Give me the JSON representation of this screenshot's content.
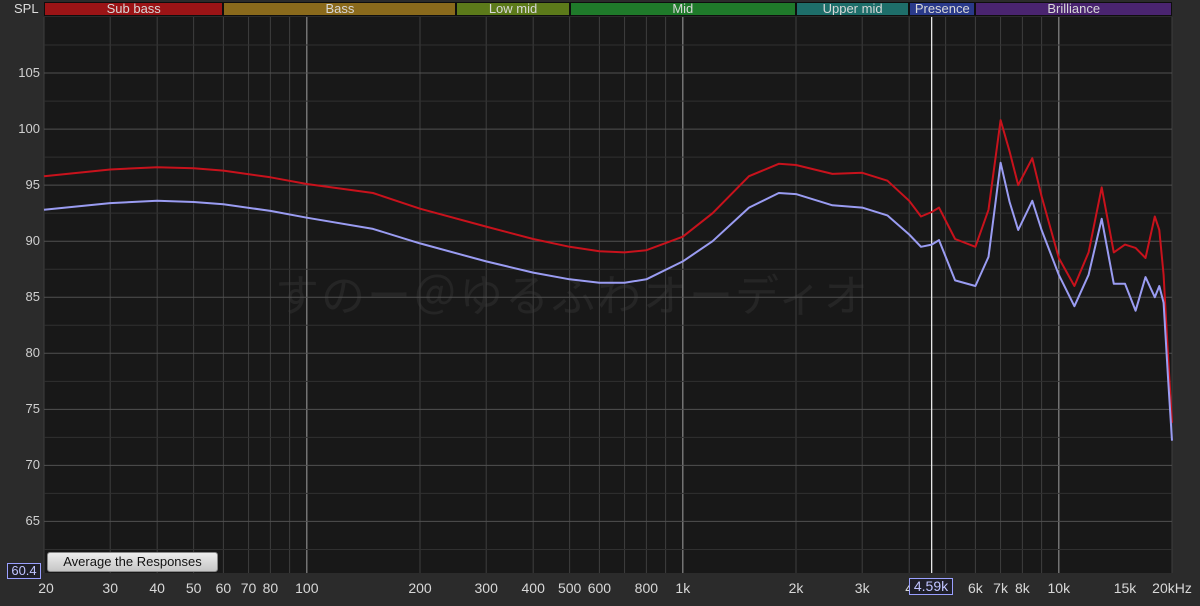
{
  "chart_data": {
    "type": "line",
    "ylabel": "SPL",
    "xscale": "log",
    "xlim": [
      20,
      20000
    ],
    "ylim": [
      60.4,
      110
    ],
    "yticks": [
      "105",
      "100",
      "95",
      "90",
      "85",
      "80",
      "75",
      "70",
      "65"
    ],
    "xticks": [
      "20",
      "30",
      "40",
      "50",
      "60",
      "70",
      "80",
      "100",
      "200",
      "300",
      "400",
      "500",
      "600",
      "800",
      "1k",
      "2k",
      "3k",
      "4",
      "6k",
      "7k",
      "8k",
      "10k",
      "15k",
      "20kHz"
    ],
    "bands": [
      {
        "name": "Sub bass",
        "from": 20,
        "to": 60,
        "color": "#9b1416"
      },
      {
        "name": "Bass",
        "from": 60,
        "to": 250,
        "color": "#8a6a1c"
      },
      {
        "name": "Low mid",
        "from": 250,
        "to": 500,
        "color": "#5c7a1a"
      },
      {
        "name": "Mid",
        "from": 500,
        "to": 2000,
        "color": "#1f7a2a"
      },
      {
        "name": "Upper mid",
        "from": 2000,
        "to": 4000,
        "color": "#1e6e6a"
      },
      {
        "name": "Presence",
        "from": 4000,
        "to": 6000,
        "color": "#2a3a8a"
      },
      {
        "name": "Brilliance",
        "from": 6000,
        "to": 20000,
        "color": "#4a2470"
      }
    ],
    "series": [
      {
        "color": "#c8121c",
        "x": [
          20,
          30,
          40,
          50,
          60,
          80,
          100,
          150,
          200,
          300,
          400,
          500,
          600,
          700,
          800,
          1000,
          1200,
          1500,
          1800,
          2000,
          2500,
          3000,
          3500,
          4000,
          4300,
          4590,
          4800,
          5300,
          6000,
          6500,
          7000,
          7400,
          7800,
          8500,
          9000,
          10000,
          11000,
          12000,
          13000,
          14000,
          15000,
          16000,
          17000,
          18000,
          18500,
          19000,
          19500,
          20000
        ],
        "y": [
          95.8,
          96.4,
          96.6,
          96.5,
          96.3,
          95.7,
          95.1,
          94.3,
          92.9,
          91.3,
          90.2,
          89.5,
          89.1,
          89.0,
          89.2,
          90.4,
          92.5,
          95.8,
          96.9,
          96.8,
          96.0,
          96.1,
          95.4,
          93.6,
          92.2,
          92.6,
          93.0,
          90.2,
          89.5,
          92.8,
          100.8,
          98.0,
          95.0,
          97.4,
          94.0,
          88.5,
          86.0,
          89.0,
          94.8,
          89.0,
          89.7,
          89.4,
          88.5,
          92.2,
          91.0,
          87.0,
          80.0,
          73.8
        ]
      },
      {
        "color": "#9a9cf2",
        "x": [
          20,
          30,
          40,
          50,
          60,
          80,
          100,
          150,
          200,
          300,
          400,
          500,
          600,
          700,
          800,
          1000,
          1200,
          1500,
          1800,
          2000,
          2500,
          3000,
          3500,
          4000,
          4300,
          4590,
          4800,
          5300,
          6000,
          6500,
          7000,
          7400,
          7800,
          8500,
          9000,
          10000,
          11000,
          12000,
          13000,
          14000,
          15000,
          16000,
          17000,
          18000,
          18500,
          19000,
          19500,
          20000
        ],
        "y": [
          92.8,
          93.4,
          93.6,
          93.5,
          93.3,
          92.7,
          92.1,
          91.1,
          89.8,
          88.2,
          87.2,
          86.6,
          86.3,
          86.3,
          86.6,
          88.2,
          90.0,
          93.0,
          94.3,
          94.2,
          93.2,
          93.0,
          92.3,
          90.6,
          89.5,
          89.7,
          90.1,
          86.5,
          86.0,
          88.6,
          97.0,
          93.5,
          91.0,
          93.6,
          91.0,
          87.0,
          84.2,
          87.0,
          92.0,
          86.2,
          86.2,
          83.8,
          86.8,
          85.0,
          86.0,
          84.5,
          78.0,
          72.2
        ]
      }
    ],
    "cursor_x": 4590,
    "y_readout": "60.4",
    "x_readout": "4.59k"
  },
  "button_label": "Average the Responses",
  "watermark": "すのー＠ゆるふわオーディオ",
  "spl_label": "SPL"
}
